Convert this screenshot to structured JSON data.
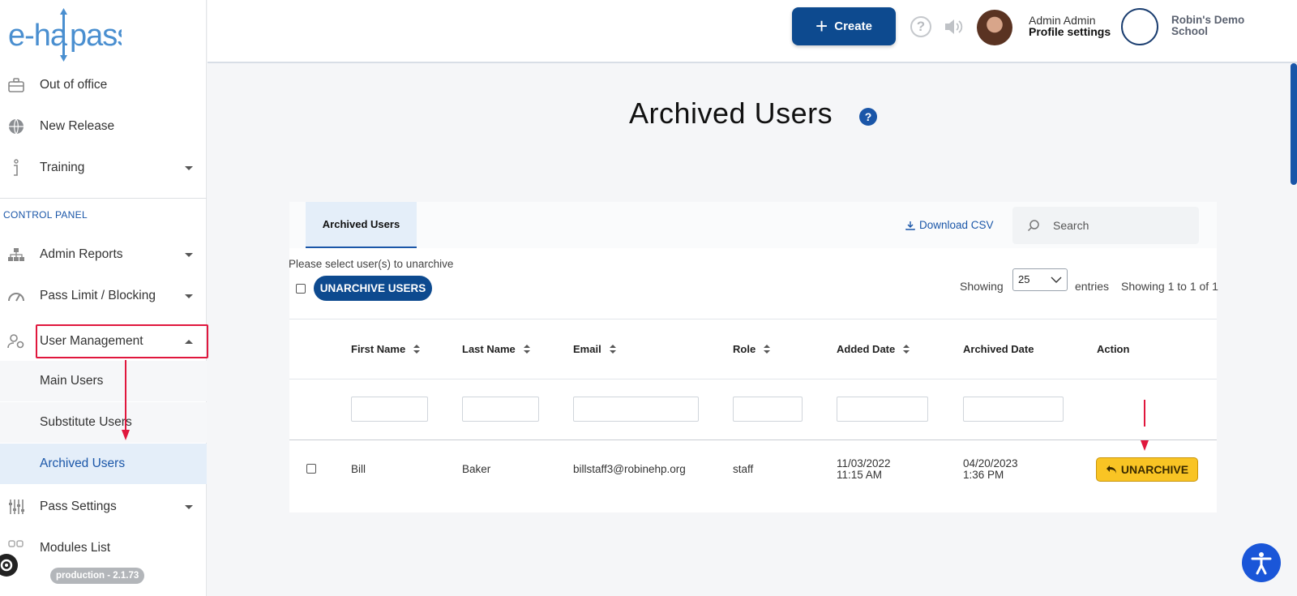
{
  "app": {
    "logo_text": "e-hallpass",
    "version": "production - 2.1.73"
  },
  "sidebar": {
    "top_items": [
      {
        "label": "Out of office",
        "icon": "briefcase-icon"
      },
      {
        "label": "New Release",
        "icon": "globe-icon"
      },
      {
        "label": "Training",
        "icon": "info-icon"
      }
    ],
    "section_title": "CONTROL PANEL",
    "panel_items": [
      {
        "label": "Admin Reports",
        "icon": "sitemap-icon"
      },
      {
        "label": "Pass Limit / Blocking",
        "icon": "gauge-icon"
      },
      {
        "label": "User Management",
        "icon": "users-gear-icon"
      }
    ],
    "sub_items": [
      {
        "label": "Main Users"
      },
      {
        "label": "Substitute Users"
      },
      {
        "label": "Archived Users"
      }
    ],
    "bottom_items": [
      {
        "label": "Pass Settings",
        "icon": "sliders-icon"
      },
      {
        "label": "Modules List",
        "icon": "modules-icon"
      }
    ]
  },
  "header": {
    "create_label": "Create",
    "profile_name": "Admin Admin",
    "profile_link": "Profile settings",
    "school_name": "Robin's Demo School"
  },
  "page": {
    "title": "Archived Users",
    "help_glyph": "?"
  },
  "tabs": {
    "active": "Archived Users"
  },
  "toolbar": {
    "download_label": "Download CSV",
    "search_placeholder": "Search",
    "instruction": "Please select user(s) to unarchive",
    "unarchive_users_label": "UNARCHIVE USERS",
    "showing_label": "Showing",
    "entries_value": "25",
    "entries_label": "entries",
    "showing_count": "Showing 1 to 1 of 1"
  },
  "table": {
    "columns": [
      "First Name",
      "Last Name",
      "Email",
      "Role",
      "Added Date",
      "Archived Date",
      "Action"
    ],
    "rows": [
      {
        "first_name": "Bill",
        "last_name": "Baker",
        "email": "billstaff3@robinehp.org",
        "role": "staff",
        "added_date": "11/03/2022",
        "added_time": "11:15 AM",
        "archived_date": "04/20/2023",
        "archived_time": "1:36 PM",
        "action_label": "UNARCHIVE"
      }
    ]
  },
  "colors": {
    "brand": "#0d4a8f",
    "accent": "#1a56a8",
    "highlight": "#e0173d",
    "unarchive": "#f9c424"
  }
}
